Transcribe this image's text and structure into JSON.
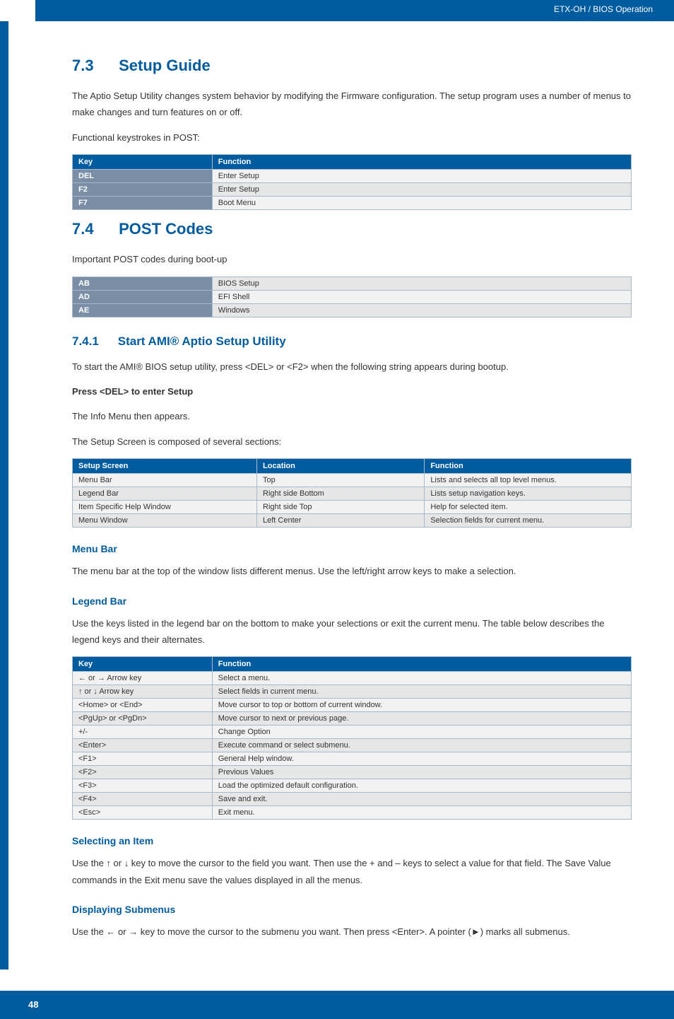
{
  "header": {
    "path": "ETX-OH / BIOS Operation"
  },
  "s73": {
    "num": "7.3",
    "title": "Setup Guide",
    "p1": "The Aptio Setup Utility changes system behavior by modifying the Firmware configuration. The setup program uses a number of menus to make changes and turn features on or off.",
    "p2": "Functional keystrokes in POST:",
    "table": {
      "h1": "Key",
      "h2": "Function",
      "rows": [
        {
          "k": "DEL",
          "f": "Enter Setup"
        },
        {
          "k": "F2",
          "f": "Enter Setup"
        },
        {
          "k": "F7",
          "f": "Boot Menu"
        }
      ]
    }
  },
  "s74": {
    "num": "7.4",
    "title": "POST Codes",
    "p1": "Important POST codes during boot-up",
    "table": {
      "rows": [
        {
          "k": "AB",
          "f": "BIOS Setup"
        },
        {
          "k": "AD",
          "f": "EFI Shell"
        },
        {
          "k": "AE",
          "f": "Windows"
        }
      ]
    }
  },
  "s741": {
    "num": "7.4.1",
    "title": "Start AMI® Aptio Setup Utility",
    "p1": "To start the AMI® BIOS setup utility, press <DEL> or <F2> when the following string appears during bootup.",
    "p2": "Press <DEL> to enter Setup",
    "p3": "The Info Menu then appears.",
    "p4": "The Setup Screen is composed of several sections:",
    "table": {
      "h1": "Setup Screen",
      "h2": "Location",
      "h3": "Function",
      "rows": [
        {
          "a": "Menu Bar",
          "b": "Top",
          "c": "Lists and selects all top level menus."
        },
        {
          "a": "Legend Bar",
          "b": "Right side Bottom",
          "c": "Lists setup navigation keys."
        },
        {
          "a": "Item Specific Help Window",
          "b": "Right side Top",
          "c": "Help for selected item."
        },
        {
          "a": "Menu Window",
          "b": "Left Center",
          "c": "Selection fields for current menu."
        }
      ]
    }
  },
  "menuBar": {
    "title": "Menu Bar",
    "p1": "The menu bar at the top of the window lists different menus. Use the left/right arrow keys to make a selection."
  },
  "legendBar": {
    "title": "Legend Bar",
    "p1": "Use the keys listed in the legend bar on the bottom to make your selections or exit the current menu. The table below describes the legend keys and their alternates.",
    "table": {
      "h1": "Key",
      "h2": "Function",
      "rows": [
        {
          "k": "← or → Arrow key",
          "f": "Select a menu."
        },
        {
          "k": "↑ or ↓ Arrow key",
          "f": "Select fields in current menu."
        },
        {
          "k": "<Home> or <End>",
          "f": "Move cursor to top or bottom of current window."
        },
        {
          "k": "<PgUp> or <PgDn>",
          "f": "Move cursor to next or previous page."
        },
        {
          "k": "+/-",
          "f": "Change Option"
        },
        {
          "k": "<Enter>",
          "f": "Execute command or select submenu."
        },
        {
          "k": "<F1>",
          "f": "General Help window."
        },
        {
          "k": "<F2>",
          "f": "Previous Values"
        },
        {
          "k": "<F3>",
          "f": "Load the optimized default configuration."
        },
        {
          "k": "<F4>",
          "f": "Save and exit."
        },
        {
          "k": "<Esc>",
          "f": "Exit menu."
        }
      ]
    }
  },
  "selecting": {
    "title": "Selecting an Item",
    "p1": "Use the ↑ or ↓ key to move the cursor to the field you want. Then use the + and – keys to select a value for that field. The Save Value commands in the Exit menu save the values displayed in all the menus."
  },
  "displaying": {
    "title": "Displaying Submenus",
    "p1": "Use the ← or → key to move the cursor to the submenu you want. Then press <Enter>. A pointer (►) marks all submenus."
  },
  "footer": {
    "page": "48"
  }
}
